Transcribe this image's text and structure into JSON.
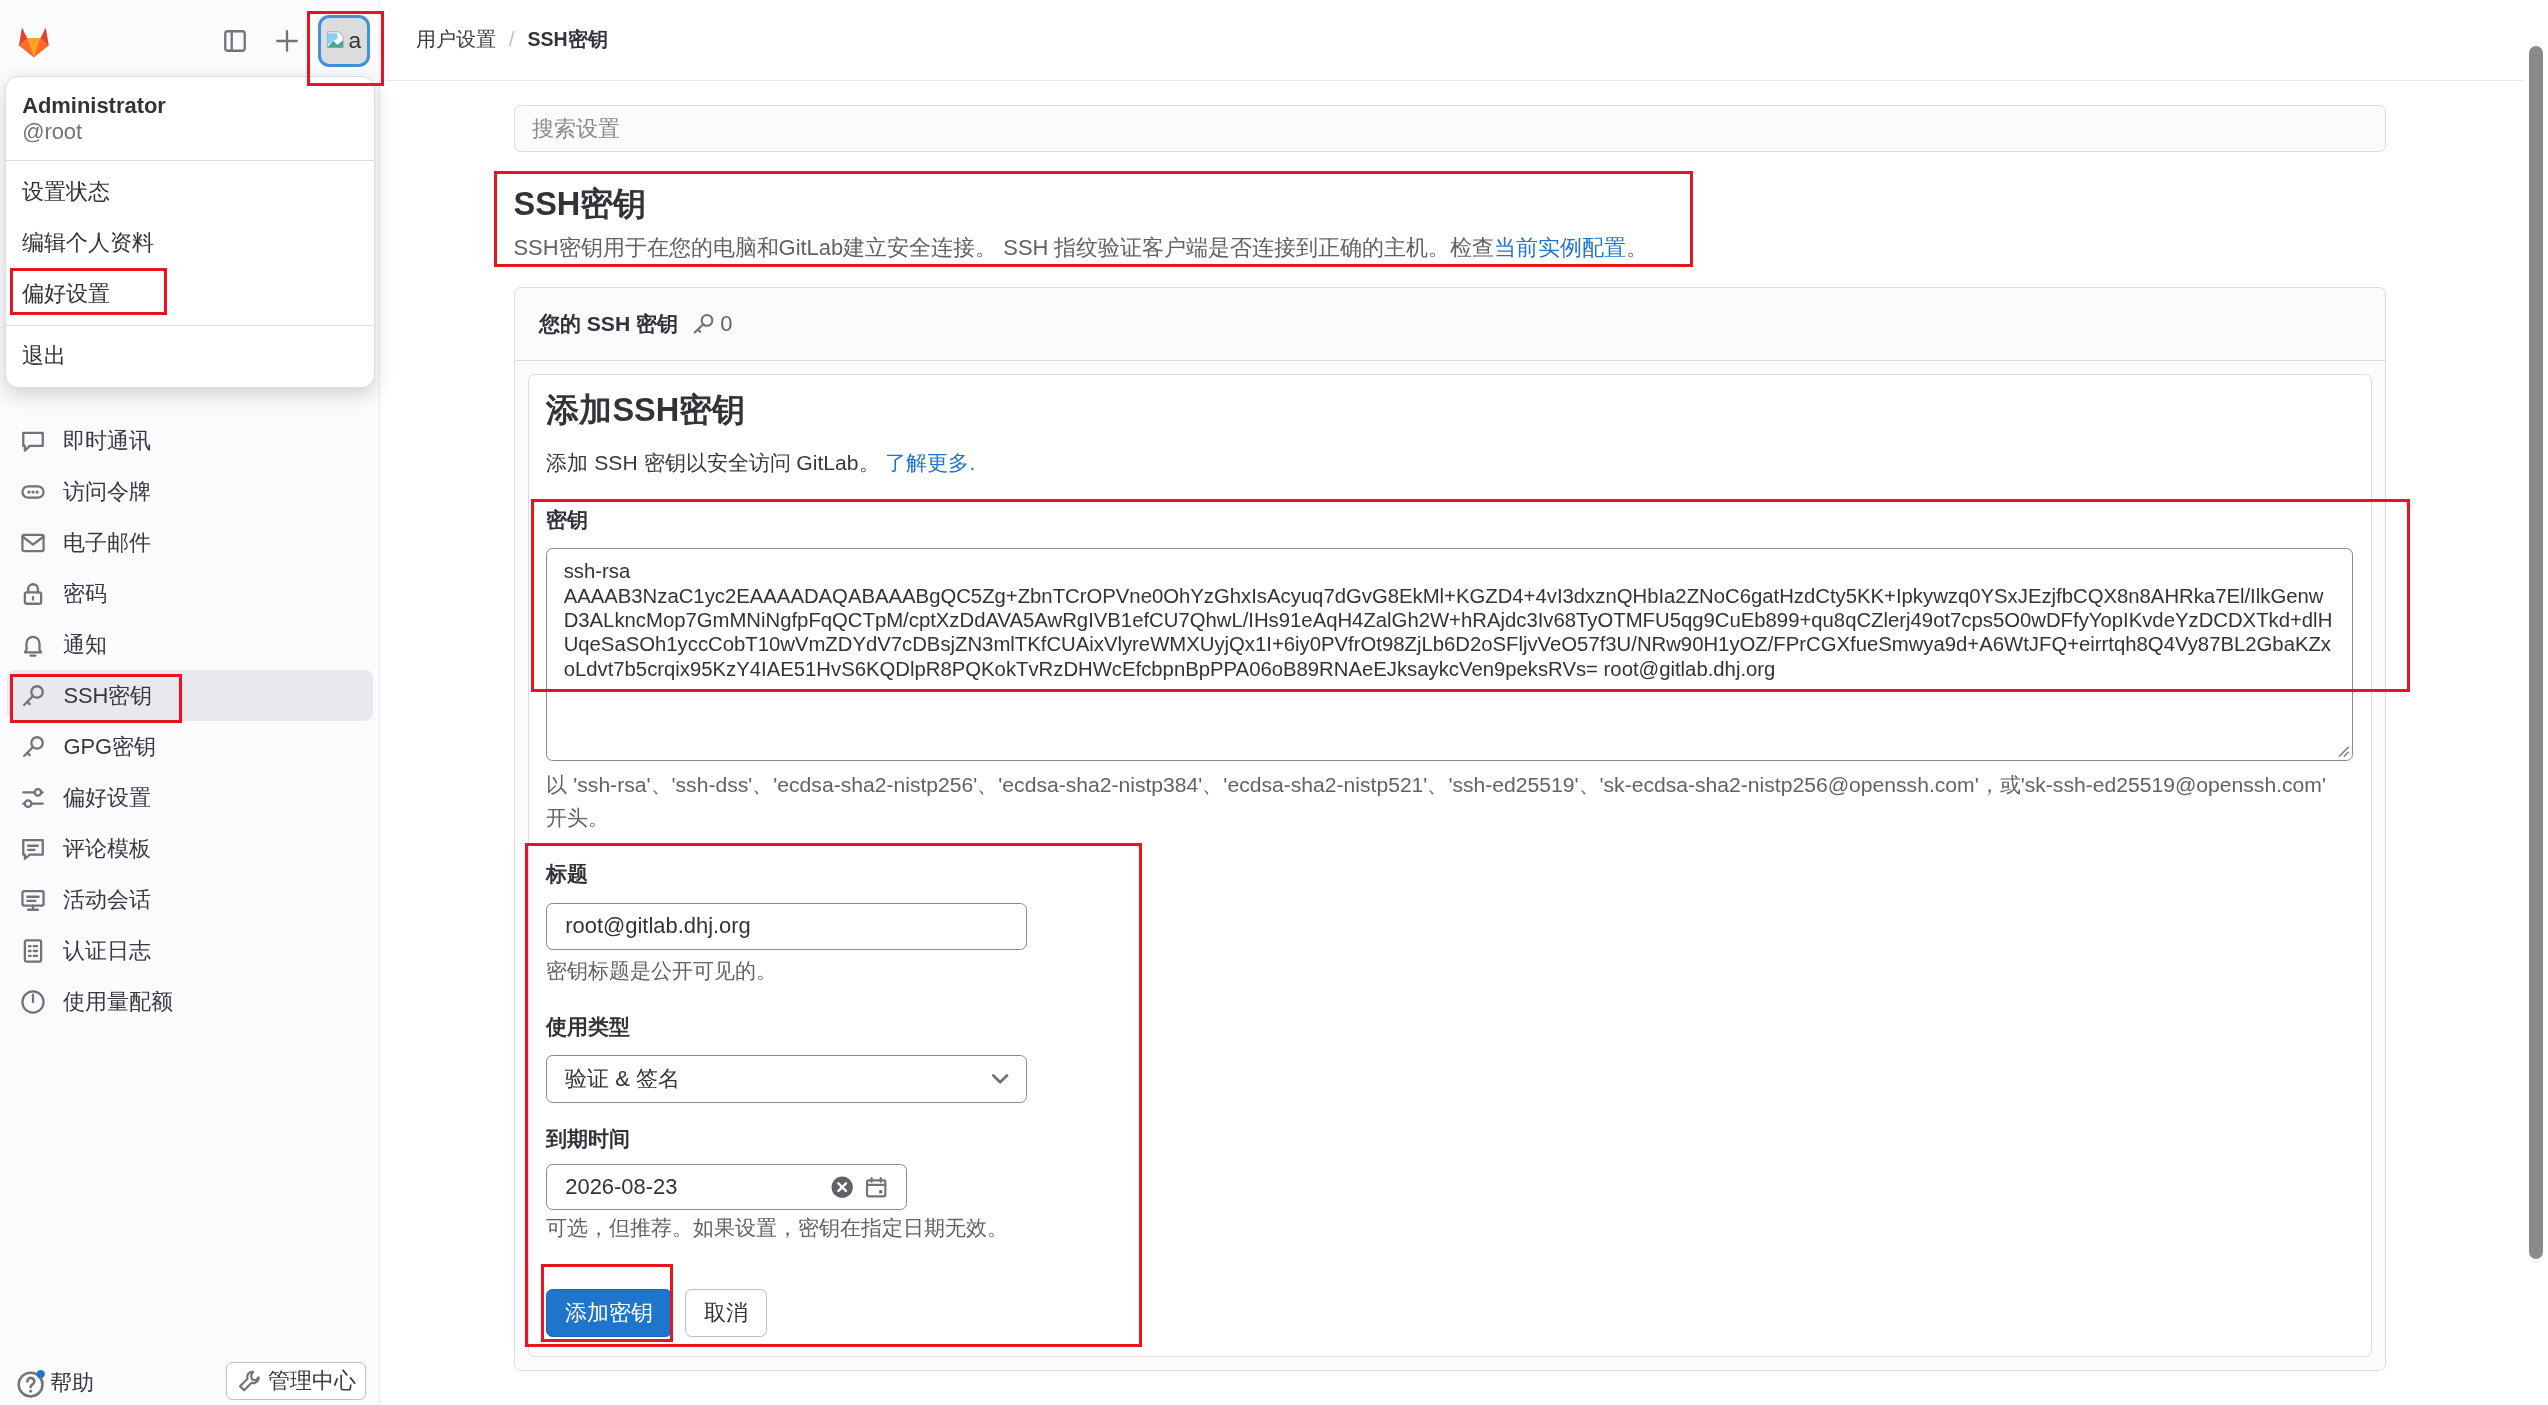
{
  "sidebar": {
    "avatar_alt": "a",
    "items": [
      {
        "label": "即时通讯",
        "selected": false
      },
      {
        "label": "访问令牌",
        "selected": false
      },
      {
        "label": "电子邮件",
        "selected": false
      },
      {
        "label": "密码",
        "selected": false
      },
      {
        "label": "通知",
        "selected": false
      },
      {
        "label": "SSH密钥",
        "selected": true
      },
      {
        "label": "GPG密钥",
        "selected": false
      },
      {
        "label": "偏好设置",
        "selected": false
      },
      {
        "label": "评论模板",
        "selected": false
      },
      {
        "label": "活动会话",
        "selected": false
      },
      {
        "label": "认证日志",
        "selected": false
      },
      {
        "label": "使用量配额",
        "selected": false
      }
    ],
    "help": "帮助",
    "admin_button": "管理中心"
  },
  "user_menu": {
    "name": "Administrator",
    "username": "@root",
    "items": [
      "设置状态",
      "编辑个人资料",
      "偏好设置"
    ],
    "sign_out": "退出"
  },
  "breadcrumb_separator": "/",
  "breadcrumbs": [
    {
      "label": "用户设置",
      "current": false
    },
    {
      "label": "SSH密钥",
      "current": true
    }
  ],
  "search": {
    "placeholder": "搜索设置"
  },
  "page": {
    "title": "SSH密钥",
    "description": "SSH密钥用于在您的电脑和GitLab建立安全连接。 SSH 指纹验证客户端是否连接到正确的主机。检查",
    "description_link": "当前实例配置",
    "description_end": "。"
  },
  "keys_card": {
    "title": "您的 SSH 密钥",
    "count": "0"
  },
  "add_form": {
    "title": "添加SSH密钥",
    "intro": "添加 SSH 密钥以安全访问 GitLab。",
    "intro_link": "了解更多.",
    "key_label": "密钥",
    "key_value": "ssh-rsa AAAAB3NzaC1yc2EAAAADAQABAAABgQC5Zg+ZbnTCrOPVne0OhYzGhxIsAcyuq7dGvG8EkMl+KGZD4+4vI3dxznQHbIa2ZNoC6gatHzdCty5KK+Ipkywzq0YSxJEzjfbCQX8n8AHRka7El/IlkGenwD3ALkncMop7GmMNiNgfpFqQCTpM/cptXzDdAVA5AwRgIVB1efCU7QhwL/IHs91eAqH4ZalGh2W+hRAjdc3Iv68TyOTMFU5qg9CuEb899+qu8qCZlerj49ot7cps5O0wDFfyYopIKvdeYzDCDXTkd+dlHUqeSaSOh1yccCobT10wVmZDYdV7cDBsjZN3mlTKfCUAixVlyreWMXUyjQx1I+6iy0PVfrOt98ZjLb6D2oSFljvVeO57f3U/NRw90H1yOZ/FPrCGXfueSmwya9d+A6WtJFQ+eirrtqh8Q4Vy87BL2GbaKZxoLdvt7b5crqix95KzY4IAE51HvS6KQDlpR8PQKokTvRzDHWcEfcbpnBpPPA06oB89RNAeEJksaykcVen9peksRVs= root@gitlab.dhj.org",
    "key_hint": "以 'ssh-rsa'、'ssh-dss'、'ecdsa-sha2-nistp256'、'ecdsa-sha2-nistp384'、'ecdsa-sha2-nistp521'、'ssh-ed25519'、'sk-ecdsa-sha2-nistp256@openssh.com'，或'sk-ssh-ed25519@openssh.com' 开头。",
    "title_label": "标题",
    "title_value": "root@gitlab.dhj.org",
    "title_help": "密钥标题是公开可见的。",
    "usage_label": "使用类型",
    "usage_value": "验证 & 签名",
    "expiry_label": "到期时间",
    "expiry_value": "2026-08-23",
    "expiry_help": "可选，但推荐。如果设置，密钥在指定日期无效。",
    "submit": "添加密钥",
    "cancel": "取消"
  }
}
